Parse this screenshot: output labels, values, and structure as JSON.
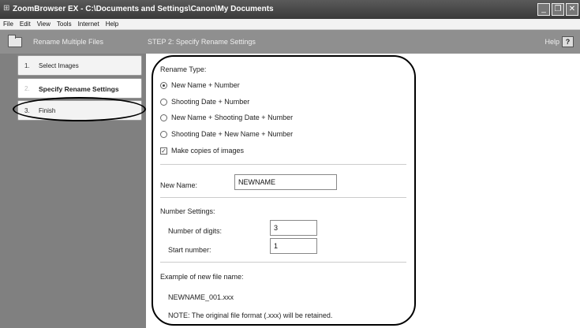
{
  "window": {
    "title": "ZoomBrowser EX  -  C:\\Documents and Settings\\Canon\\My Documents",
    "minimize": "_",
    "restore": "❐",
    "close": "✕"
  },
  "menu": [
    "File",
    "Edit",
    "View",
    "Tools",
    "Internet",
    "Help"
  ],
  "header": {
    "sidebar_title": "Rename Multiple Files",
    "step_title": "STEP 2: Specify Rename Settings",
    "help_label": "Help",
    "help_button": "?"
  },
  "steps": [
    {
      "num": "1.",
      "label": "Select Images"
    },
    {
      "num": "2.",
      "label": "Specify Rename Settings"
    },
    {
      "num": "3.",
      "label": "Finish"
    }
  ],
  "rename_type": {
    "label": "Rename Type:",
    "options": [
      "New Name + Number",
      "Shooting Date + Number",
      "New Name + Shooting Date + Number",
      "Shooting Date + New Name + Number"
    ],
    "selected_index": 0
  },
  "copy_option": {
    "label": "Make copies of images",
    "checked": true,
    "mark": "✓"
  },
  "new_name": {
    "label": "New Name:",
    "value": "NEWNAME"
  },
  "number_settings": {
    "label": "Number Settings:",
    "digits_label": "Number of digits:",
    "digits_value": "3",
    "start_label": "Start number:",
    "start_value": "1"
  },
  "example": {
    "label": "Example of new file name:",
    "value": "NEWNAME_001.xxx",
    "note": "NOTE: The original file format (.xxx) will be retained."
  }
}
